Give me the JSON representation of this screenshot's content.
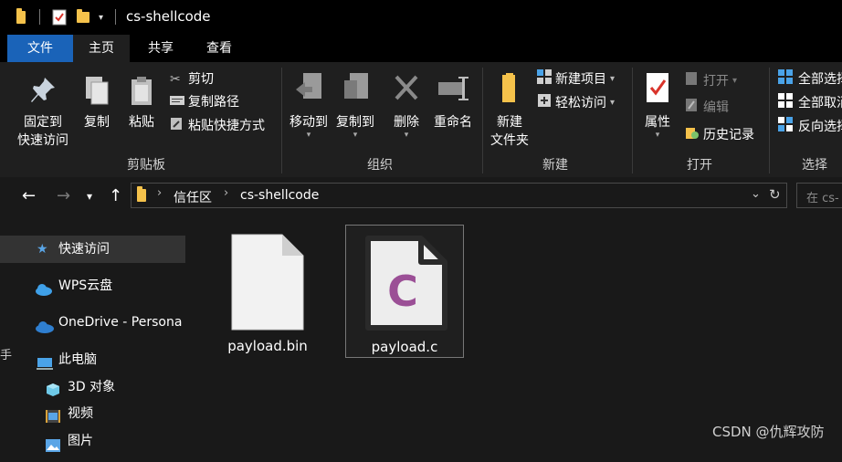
{
  "window": {
    "title": "cs-shellcode"
  },
  "ribbon_tabs": [
    "文件",
    "主页",
    "共享",
    "查看"
  ],
  "clipboard": {
    "label": "剪贴板",
    "pin_line1": "固定到",
    "pin_line2": "快速访问",
    "copy": "复制",
    "paste": "粘贴",
    "cut": "剪切",
    "copy_path": "复制路径",
    "paste_shortcut": "粘贴快捷方式"
  },
  "organize": {
    "label": "组织",
    "move_to": "移动到",
    "copy_to": "复制到",
    "delete": "删除",
    "rename": "重命名"
  },
  "new": {
    "label": "新建",
    "new_folder_line1": "新建",
    "new_folder_line2": "文件夹",
    "new_item": "新建项目",
    "easy_access": "轻松访问"
  },
  "open": {
    "label": "打开",
    "properties": "属性",
    "open": "打开",
    "edit": "编辑",
    "history": "历史记录"
  },
  "select": {
    "label": "选择",
    "select_all": "全部选择",
    "select_none": "全部取消",
    "invert": "反向选择"
  },
  "address": {
    "parts": [
      "信任区",
      "cs-shellcode"
    ],
    "search_placeholder": "在 cs-"
  },
  "nav": [
    {
      "label": "快速访问",
      "icon": "star-icon"
    },
    {
      "label": "WPS云盘",
      "icon": "cloud-icon"
    },
    {
      "label": "OneDrive - Persona",
      "icon": "cloud-icon"
    },
    {
      "label": "此电脑",
      "icon": "computer-icon"
    },
    {
      "label": "3D 对象",
      "icon": "cube-icon"
    },
    {
      "label": "视频",
      "icon": "video-icon"
    },
    {
      "label": "图片",
      "icon": "picture-icon"
    }
  ],
  "files": [
    {
      "name": "payload.bin",
      "icon": "blank-file-icon"
    },
    {
      "name": "payload.c",
      "icon": "c-file-icon",
      "icon_letter": "C"
    }
  ],
  "watermark": "CSDN @仇辉攻防",
  "edge_char": "手",
  "colors": {
    "accent": "#1a63b8",
    "folder": "#f5c24b",
    "c_purple": "#9b4f96"
  }
}
